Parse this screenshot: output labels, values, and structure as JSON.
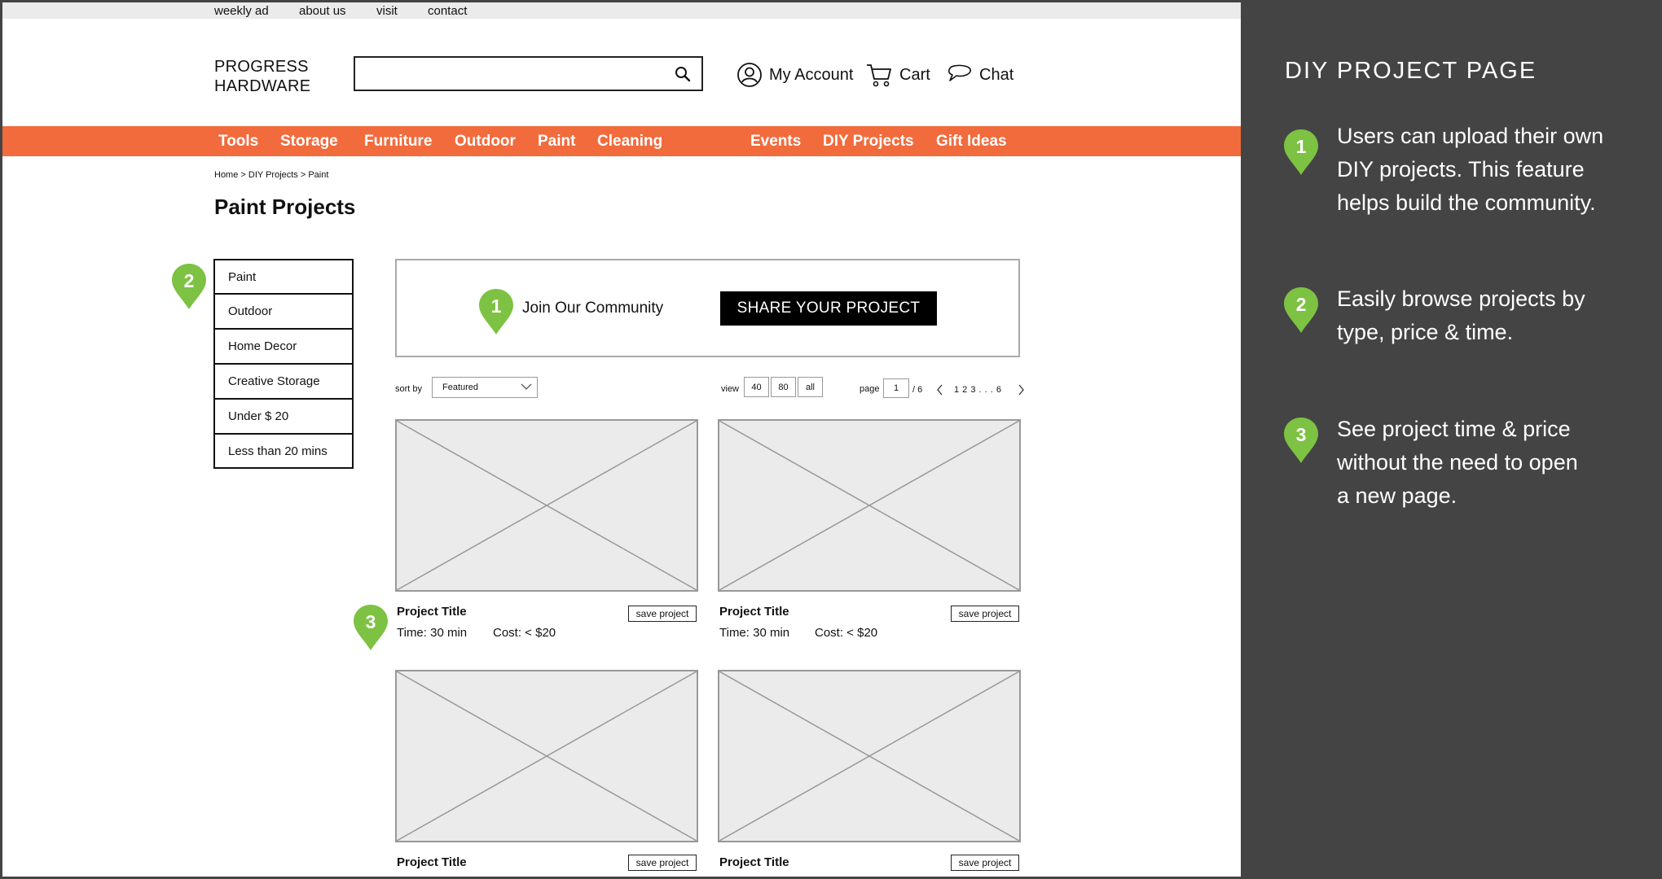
{
  "topbar": {
    "links": [
      "weekly ad",
      "about us",
      "visit",
      "contact"
    ]
  },
  "header": {
    "logo_line1": "PROGRESS",
    "logo_line2": "HARDWARE",
    "search_value": "",
    "account_label": "My Account",
    "cart_label": "Cart",
    "chat_label": "Chat"
  },
  "nav": {
    "left": [
      "Tools",
      "Storage",
      "Furniture",
      "Outdoor",
      "Paint",
      "Cleaning"
    ],
    "right": [
      "Events",
      "DIY Projects",
      "Gift Ideas"
    ]
  },
  "breadcrumb": "Home > DIY Projects > Paint",
  "page_title": "Paint Projects",
  "filters": [
    "Paint",
    "Outdoor",
    "Home Decor",
    "Creative Storage",
    "Under $ 20",
    "Less than 20 mins"
  ],
  "community": {
    "text": "Join Our Community",
    "button": "SHARE YOUR PROJECT"
  },
  "controls": {
    "sort_label": "sort by",
    "sort_value": "Featured",
    "view_label": "view",
    "view_options": [
      "40",
      "80",
      "all"
    ],
    "page_label": "page",
    "page_value": "1",
    "page_total": "/ 6",
    "page_links": "1 2 3 . . . 6"
  },
  "cards": [
    {
      "title": "Project Title",
      "time": "Time: 30 min",
      "cost": "Cost: < $20",
      "save": "save project"
    },
    {
      "title": "Project Title",
      "time": "Time: 30 min",
      "cost": "Cost: < $20",
      "save": "save project"
    },
    {
      "title": "Project Title",
      "save": "save project"
    },
    {
      "title": "Project Title",
      "save": "save project"
    }
  ],
  "markers": [
    "1",
    "2",
    "3"
  ],
  "sidebar": {
    "title": "DIY PROJECT PAGE",
    "notes": [
      {
        "num": "1",
        "lines": [
          "Users can upload their own",
          "DIY projects. This feature",
          "helps build the community."
        ]
      },
      {
        "num": "2",
        "lines": [
          "Easily browse projects by",
          "type, price & time."
        ]
      },
      {
        "num": "3",
        "lines": [
          "See project time & price",
          "without the need to open",
          "a new page."
        ]
      }
    ]
  },
  "colors": {
    "accent": "#f26b3d",
    "marker": "#7dc242",
    "panel": "#444444"
  }
}
